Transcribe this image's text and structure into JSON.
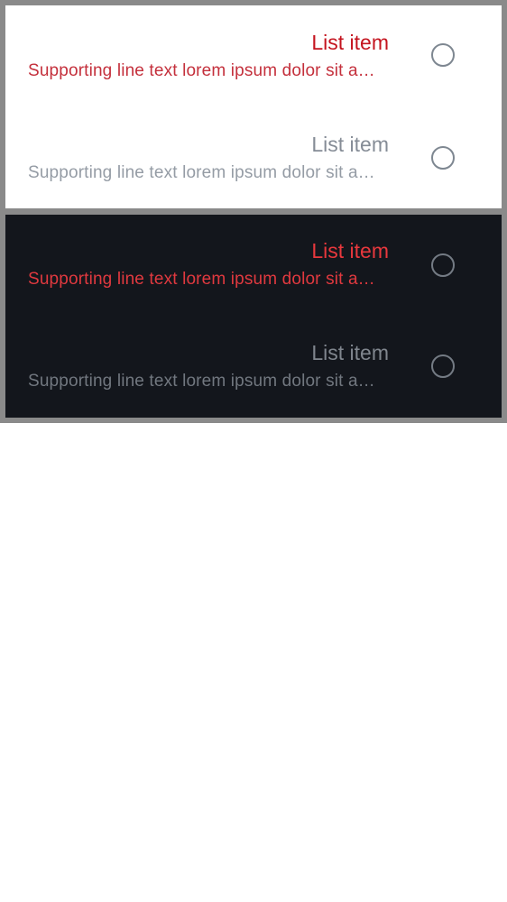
{
  "colors": {
    "frame": "#8a8a8a",
    "light_surface": "#ffffff",
    "dark_surface": "#13161c",
    "error_light": "#c4141f",
    "error_dark": "#e8383d",
    "disabled_text": "#858c96",
    "radio_outline": "#7e8791"
  },
  "light_list": {
    "items": [
      {
        "headline": "List item",
        "supporting": "Supporting line text lorem ipsum dolor sit amet, consectetur",
        "state": "error",
        "radio_selected": false,
        "icon": "radio-unchecked-icon"
      },
      {
        "headline": "List item",
        "supporting": "Supporting line text lorem ipsum dolor sit amet, consectetur",
        "state": "disabled",
        "radio_selected": false,
        "icon": "radio-unchecked-icon"
      }
    ]
  },
  "dark_list": {
    "items": [
      {
        "headline": "List item",
        "supporting": "Supporting line text lorem ipsum dolor sit amet, consectetur",
        "state": "error",
        "radio_selected": false,
        "icon": "radio-unchecked-icon"
      },
      {
        "headline": "List item",
        "supporting": "Supporting line text lorem ipsum dolor sit amet, consectetur",
        "state": "disabled",
        "radio_selected": false,
        "icon": "radio-unchecked-icon"
      }
    ]
  }
}
